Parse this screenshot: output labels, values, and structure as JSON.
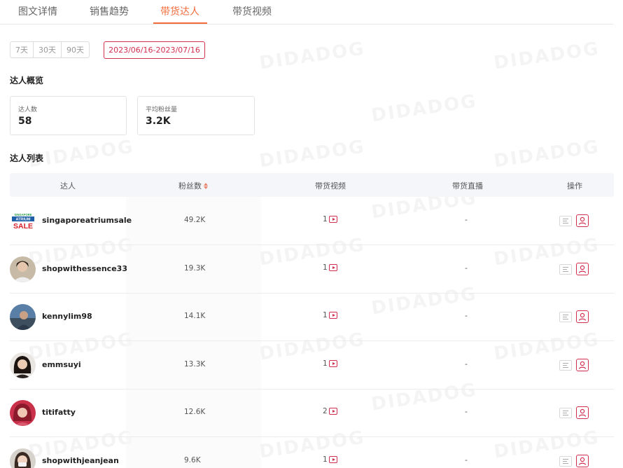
{
  "tabs": [
    {
      "label": "图文详情",
      "active": false
    },
    {
      "label": "销售趋势",
      "active": false
    },
    {
      "label": "带货达人",
      "active": true
    },
    {
      "label": "带货视频",
      "active": false
    }
  ],
  "date_range": {
    "options": [
      "7天",
      "30天",
      "90天"
    ],
    "selected": "2023/06/16-2023/07/16"
  },
  "overview": {
    "title": "达人概览",
    "stats": [
      {
        "label": "达人数",
        "value": "58"
      },
      {
        "label": "平均粉丝量",
        "value": "3.2K"
      }
    ]
  },
  "list": {
    "title": "达人列表",
    "columns": [
      "达人",
      "粉丝数",
      "带货视频",
      "带货直播",
      "操作"
    ],
    "rows": [
      {
        "name": "singaporeatriumsale",
        "fans": "49.2K",
        "videos": "1",
        "live": "-",
        "avatar": "sale-logo"
      },
      {
        "name": "shopwithessence33",
        "fans": "19.3K",
        "videos": "1",
        "live": "-",
        "avatar": "photo"
      },
      {
        "name": "kennylim98",
        "fans": "14.1K",
        "videos": "1",
        "live": "-",
        "avatar": "photo"
      },
      {
        "name": "emmsuyi",
        "fans": "13.3K",
        "videos": "1",
        "live": "-",
        "avatar": "photo"
      },
      {
        "name": "titifatty",
        "fans": "12.6K",
        "videos": "2",
        "live": "-",
        "avatar": "photo"
      },
      {
        "name": "shopwithjeanjean",
        "fans": "9.6K",
        "videos": "1",
        "live": "-",
        "avatar": "photo"
      }
    ]
  },
  "logo_text": {
    "top": "SINGAPORE",
    "middle": "ATRIUM",
    "bottom": "SALE"
  },
  "watermark": "DIDADOG",
  "colors": {
    "accent": "#f26b3a",
    "brand": "#d22f4f",
    "header_bg": "#f5f6fa"
  }
}
